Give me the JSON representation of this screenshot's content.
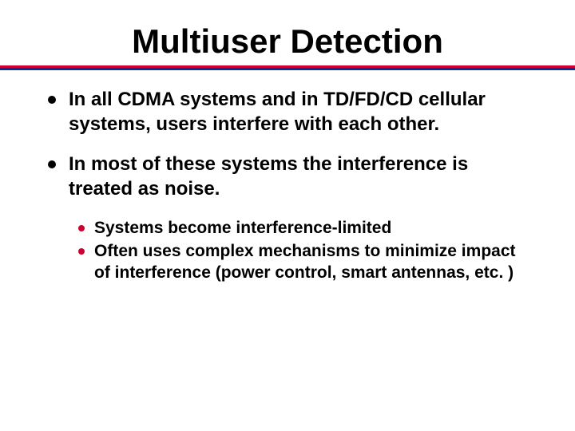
{
  "title": "Multiuser Detection",
  "bullets": [
    {
      "text": "In all CDMA systems and in TD/FD/CD cellular systems, users interfere with each other."
    },
    {
      "text": "In most of these systems the interference is treated as noise.",
      "sub": [
        "Systems become interference-limited",
        "Often uses complex mechanisms to minimize impact of interference (power control, smart antennas, etc. )"
      ]
    }
  ]
}
